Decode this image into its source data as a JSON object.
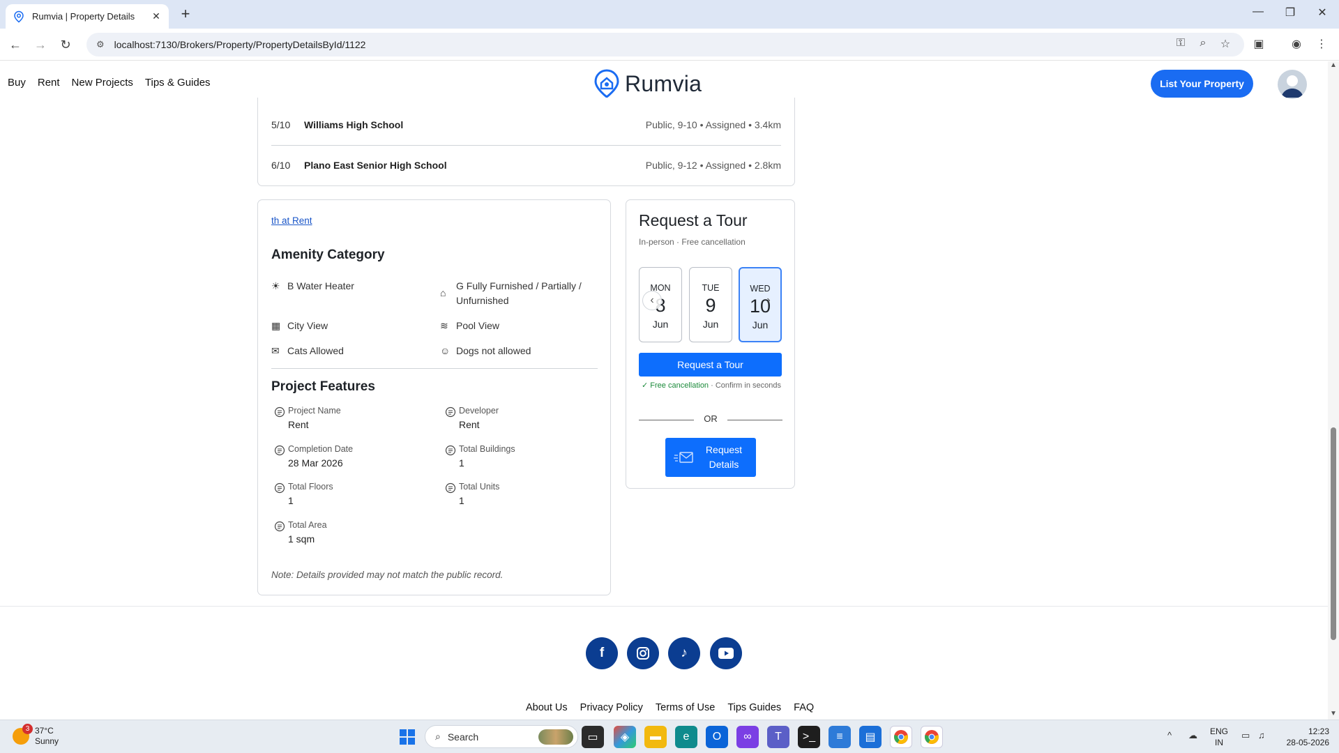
{
  "browser": {
    "tab_title": "Rumvia | Property Details",
    "url": "localhost:7130/Brokers/Property/PropertyDetailsById/1122"
  },
  "header": {
    "nav": [
      "Buy",
      "Rent",
      "New Projects",
      "Tips & Guides"
    ],
    "logo_text": "Rumvia",
    "list_button": "List Your Property"
  },
  "schools": [
    {
      "score": "5/10",
      "name": "Williams High School",
      "meta": "Public, 9-10 • Assigned • 3.4km"
    },
    {
      "score": "6/10",
      "name": "Plano East Senior High School",
      "meta": "Public, 9-12 • Assigned • 2.8km"
    }
  ],
  "details": {
    "link_text": "th at Rent",
    "amenity_heading": "Amenity Category",
    "amenities": [
      {
        "icon": "sun-icon",
        "glyph": "☀",
        "label": "B Water Heater"
      },
      {
        "icon": "home-icon",
        "glyph": "⌂",
        "label": "G Fully Furnished / Partially / Unfurnished"
      },
      {
        "icon": "building-icon",
        "glyph": "▦",
        "label": "City View"
      },
      {
        "icon": "pool-icon",
        "glyph": "≋",
        "label": "Pool View"
      },
      {
        "icon": "cat-icon",
        "glyph": "✉",
        "label": "Cats Allowed"
      },
      {
        "icon": "dog-icon",
        "glyph": "☺",
        "label": "Dogs not allowed"
      }
    ],
    "features_heading": "Project Features",
    "features": [
      {
        "label": "Project Name",
        "value": "Rent"
      },
      {
        "label": "Developer",
        "value": "Rent"
      },
      {
        "label": "Completion Date",
        "value": "28 Mar 2026"
      },
      {
        "label": "Total Buildings",
        "value": "1"
      },
      {
        "label": "Total Floors",
        "value": "1"
      },
      {
        "label": "Total Units",
        "value": "1"
      },
      {
        "label": "Total Area",
        "value": "1 sqm"
      }
    ],
    "note": "Note: Details provided may not match the public record."
  },
  "tour": {
    "title": "Request a Tour",
    "subtitle": "In-person · Free cancellation",
    "dates": [
      {
        "dow": "MON",
        "day": "8",
        "month": "Jun"
      },
      {
        "dow": "TUE",
        "day": "9",
        "month": "Jun"
      },
      {
        "dow": "WED",
        "day": "10",
        "month": "Jun"
      }
    ],
    "button": "Request a Tour",
    "free_ok": "Free cancellation",
    "free_rest": "· Confirm in seconds",
    "or": "OR",
    "details_button": "Request Details"
  },
  "footer": {
    "links": [
      "About Us",
      "Privacy Policy",
      "Terms of Use",
      "Tips Guides",
      "FAQ"
    ],
    "social_color": "#0b3d91"
  },
  "taskbar": {
    "weather_badge": "3",
    "temp": "37°C",
    "condition": "Sunny",
    "search": "Search",
    "lang1": "ENG",
    "lang2": "IN",
    "time": "12:23",
    "date": "28-05-2026"
  },
  "colors": {
    "primary": "#0d6efd",
    "brand_blue": "#1a6cf2"
  }
}
